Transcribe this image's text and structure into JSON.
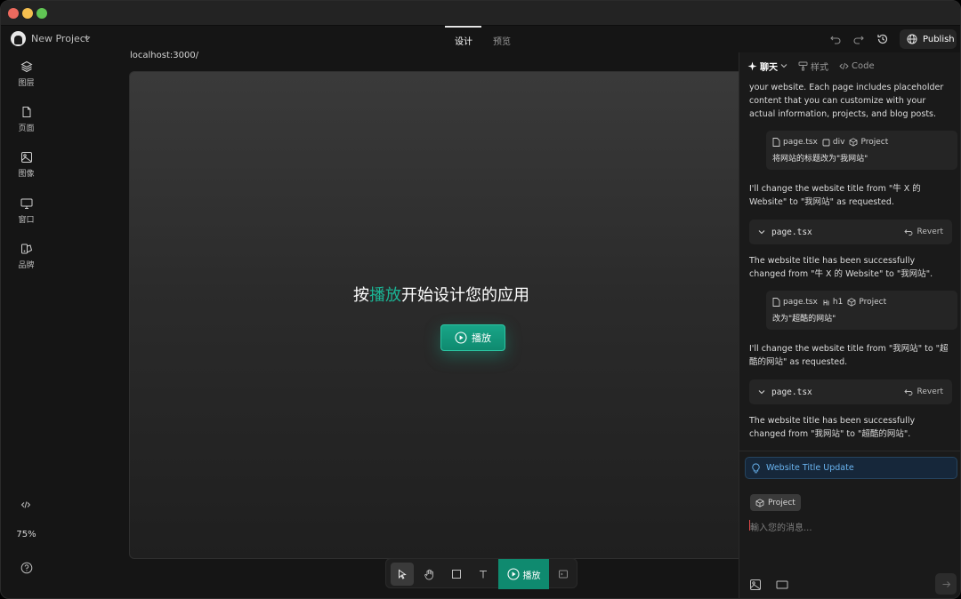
{
  "window": {
    "project_name": "New Project",
    "tabs": [
      {
        "label": "设计",
        "active": true
      },
      {
        "label": "预览",
        "active": false
      }
    ],
    "publish_label": "Publish"
  },
  "sidebar": {
    "items": [
      {
        "label": "图层",
        "icon": "layers-icon"
      },
      {
        "label": "页面",
        "icon": "page-icon"
      },
      {
        "label": "图像",
        "icon": "image-icon"
      },
      {
        "label": "窗口",
        "icon": "monitor-icon"
      },
      {
        "label": "品牌",
        "icon": "brand-icon"
      }
    ],
    "zoom": "75%"
  },
  "canvas": {
    "url": "localhost:3000/",
    "headline_pre": "按",
    "headline_accent": "播放",
    "headline_post": "开始设计您的应用",
    "play_label": "播放",
    "accent_color": "#1bb394"
  },
  "palette": {
    "play_label": "播放"
  },
  "panel": {
    "tabs": [
      {
        "label": "聊天",
        "active": true
      },
      {
        "label": "样式",
        "active": false
      },
      {
        "label": "Code",
        "active": false
      }
    ],
    "messages": {
      "intro": "your website. Each page includes placeholder content that you can customize with your actual information, projects, and blog posts.",
      "user1": {
        "file": "page.tsx",
        "element": "div",
        "scope": "Project",
        "text": "将网站的标题改为\"我网站\""
      },
      "reply1": "I'll change the website title from \"牛 X 的 Website\" to \"我网站\" as requested.",
      "code1": {
        "file": "page.tsx",
        "revert": "Revert"
      },
      "done1": "The website title has been successfully changed from \"牛 X 的 Website\" to \"我网站\".",
      "user2": {
        "file": "page.tsx",
        "element": "h1",
        "scope": "Project",
        "text": "改为\"超酷的网站\""
      },
      "reply2": "I'll change the website title from \"我网站\" to \"超酷的网站\" as requested.",
      "code2": {
        "file": "page.tsx",
        "revert": "Revert"
      },
      "done2": "The website title has been successfully changed from \"我网站\" to \"超酷的网站\"."
    },
    "suggestion": "Website Title Update",
    "project_chip": "Project",
    "input_placeholder": "輸入您的消息..."
  }
}
